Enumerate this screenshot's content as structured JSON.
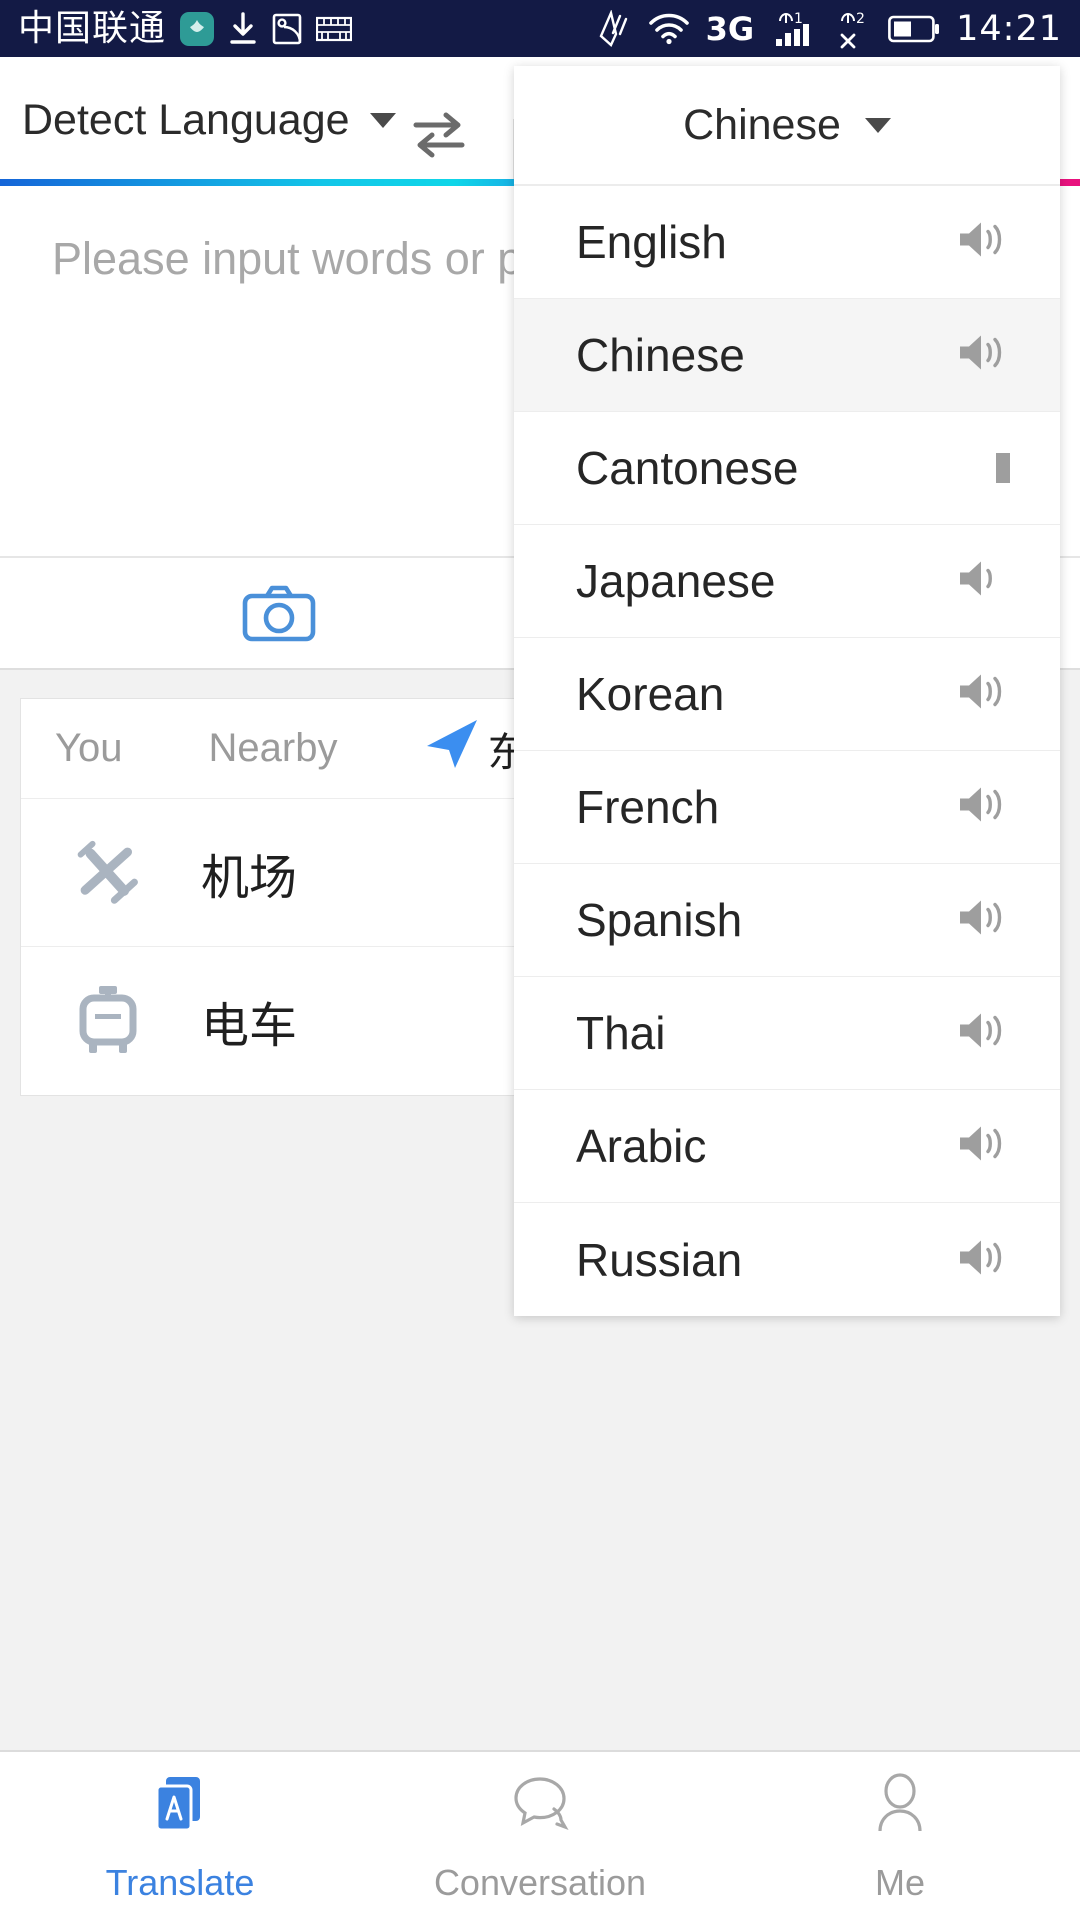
{
  "status_bar": {
    "carrier": "中国联通",
    "vendor_badge": "HUAWEI",
    "time": "14:21",
    "network_type": "3G",
    "sim1_label": "1",
    "sim2_label": "2",
    "icons": [
      "huawei-badge-icon",
      "download-icon",
      "photo-icon",
      "keyboard-icon",
      "nfc-icon",
      "wifi-icon",
      "signal-sim1-icon",
      "signal-sim2-icon",
      "battery-icon"
    ],
    "background": "#131a45"
  },
  "language_bar": {
    "source_language": "Detect Language",
    "target_language": "Chinese",
    "swap_icon": "swap-arrows-icon",
    "caret_icon": "chevron-down-icon"
  },
  "gradient": {
    "colors": [
      "#1565d8",
      "#13c6e8",
      "#3a22d6",
      "#8c1ad6",
      "#e8127e"
    ]
  },
  "input": {
    "placeholder": "Please input words or phrases to be translated",
    "value": ""
  },
  "camera": {
    "icon": "camera-icon",
    "color": "#4a90d9"
  },
  "suggestions": {
    "tab_you": "You",
    "tab_nearby": "Nearby",
    "place": "东京国际",
    "location_icon": "navigation-arrow-icon",
    "rows": [
      {
        "icon": "airplane-icon",
        "label": "机场"
      },
      {
        "icon": "tram-icon",
        "label": "电车"
      }
    ]
  },
  "dropdown": {
    "header_label": "Chinese",
    "selected": "Chinese",
    "items": [
      {
        "label": "English",
        "speaker": "speaker-icon",
        "selected": false
      },
      {
        "label": "Chinese",
        "speaker": "speaker-icon",
        "selected": true
      },
      {
        "label": "Cantonese",
        "speaker": "speaker-icon-clipped",
        "selected": false
      },
      {
        "label": "Japanese",
        "speaker": "speaker-icon",
        "selected": false
      },
      {
        "label": "Korean",
        "speaker": "speaker-icon",
        "selected": false
      },
      {
        "label": "French",
        "speaker": "speaker-icon",
        "selected": false
      },
      {
        "label": "Spanish",
        "speaker": "speaker-icon",
        "selected": false
      },
      {
        "label": "Thai",
        "speaker": "speaker-icon",
        "selected": false
      },
      {
        "label": "Arabic",
        "speaker": "speaker-icon",
        "selected": false
      },
      {
        "label": "Russian",
        "speaker": "speaker-icon",
        "selected": false
      }
    ]
  },
  "bottom_nav": {
    "active": "Translate",
    "accent": "#3b82e0",
    "items": [
      {
        "label": "Translate",
        "icon": "translate-icon"
      },
      {
        "label": "Conversation",
        "icon": "speech-bubbles-icon"
      },
      {
        "label": "Me",
        "icon": "person-icon"
      }
    ]
  }
}
